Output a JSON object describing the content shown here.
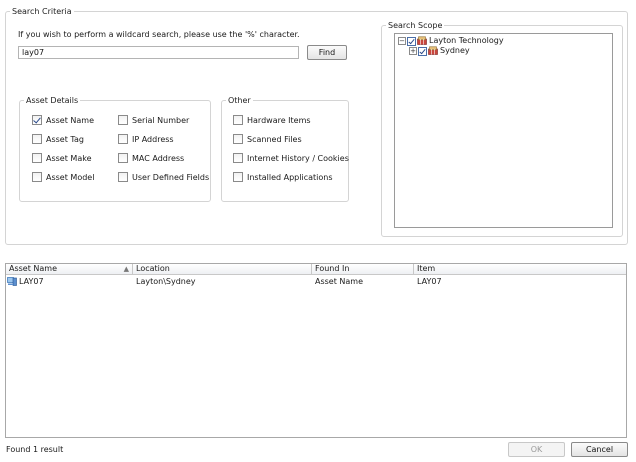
{
  "search_criteria": {
    "title": "Search Criteria",
    "hint": "If you wish to perform a wildcard search, please use the '%' character.",
    "query": "lay07",
    "find_label": "Find"
  },
  "asset_details": {
    "title": "Asset Details",
    "items": [
      {
        "label": "Asset Name",
        "checked": true
      },
      {
        "label": "Asset Tag",
        "checked": false
      },
      {
        "label": "Asset Make",
        "checked": false
      },
      {
        "label": "Asset Model",
        "checked": false
      },
      {
        "label": "Serial Number",
        "checked": false
      },
      {
        "label": "IP Address",
        "checked": false
      },
      {
        "label": "MAC Address",
        "checked": false
      },
      {
        "label": "User Defined Fields",
        "checked": false
      }
    ]
  },
  "other": {
    "title": "Other",
    "items": [
      {
        "label": "Hardware Items",
        "checked": false
      },
      {
        "label": "Scanned Files",
        "checked": false
      },
      {
        "label": "Internet History / Cookies",
        "checked": false
      },
      {
        "label": "Installed Applications",
        "checked": false
      }
    ]
  },
  "search_scope": {
    "title": "Search Scope",
    "tree": [
      {
        "label": "Layton Technology",
        "expander": "⊟",
        "checked": true
      },
      {
        "label": "Sydney",
        "expander": "⊞",
        "checked": true
      }
    ]
  },
  "results": {
    "columns": [
      "Asset Name",
      "Location",
      "Found In",
      "Item"
    ],
    "rows": [
      {
        "asset_name": "LAY07",
        "location": "Layton\\Sydney",
        "found_in": "Asset Name",
        "item": "LAY07"
      }
    ]
  },
  "footer": {
    "status": "Found 1 result",
    "ok_label": "OK",
    "cancel_label": "Cancel"
  },
  "colors": {
    "accent": "#2a4a8a",
    "border": "#d4d4d4",
    "selection_icon": "#2f6db5"
  }
}
